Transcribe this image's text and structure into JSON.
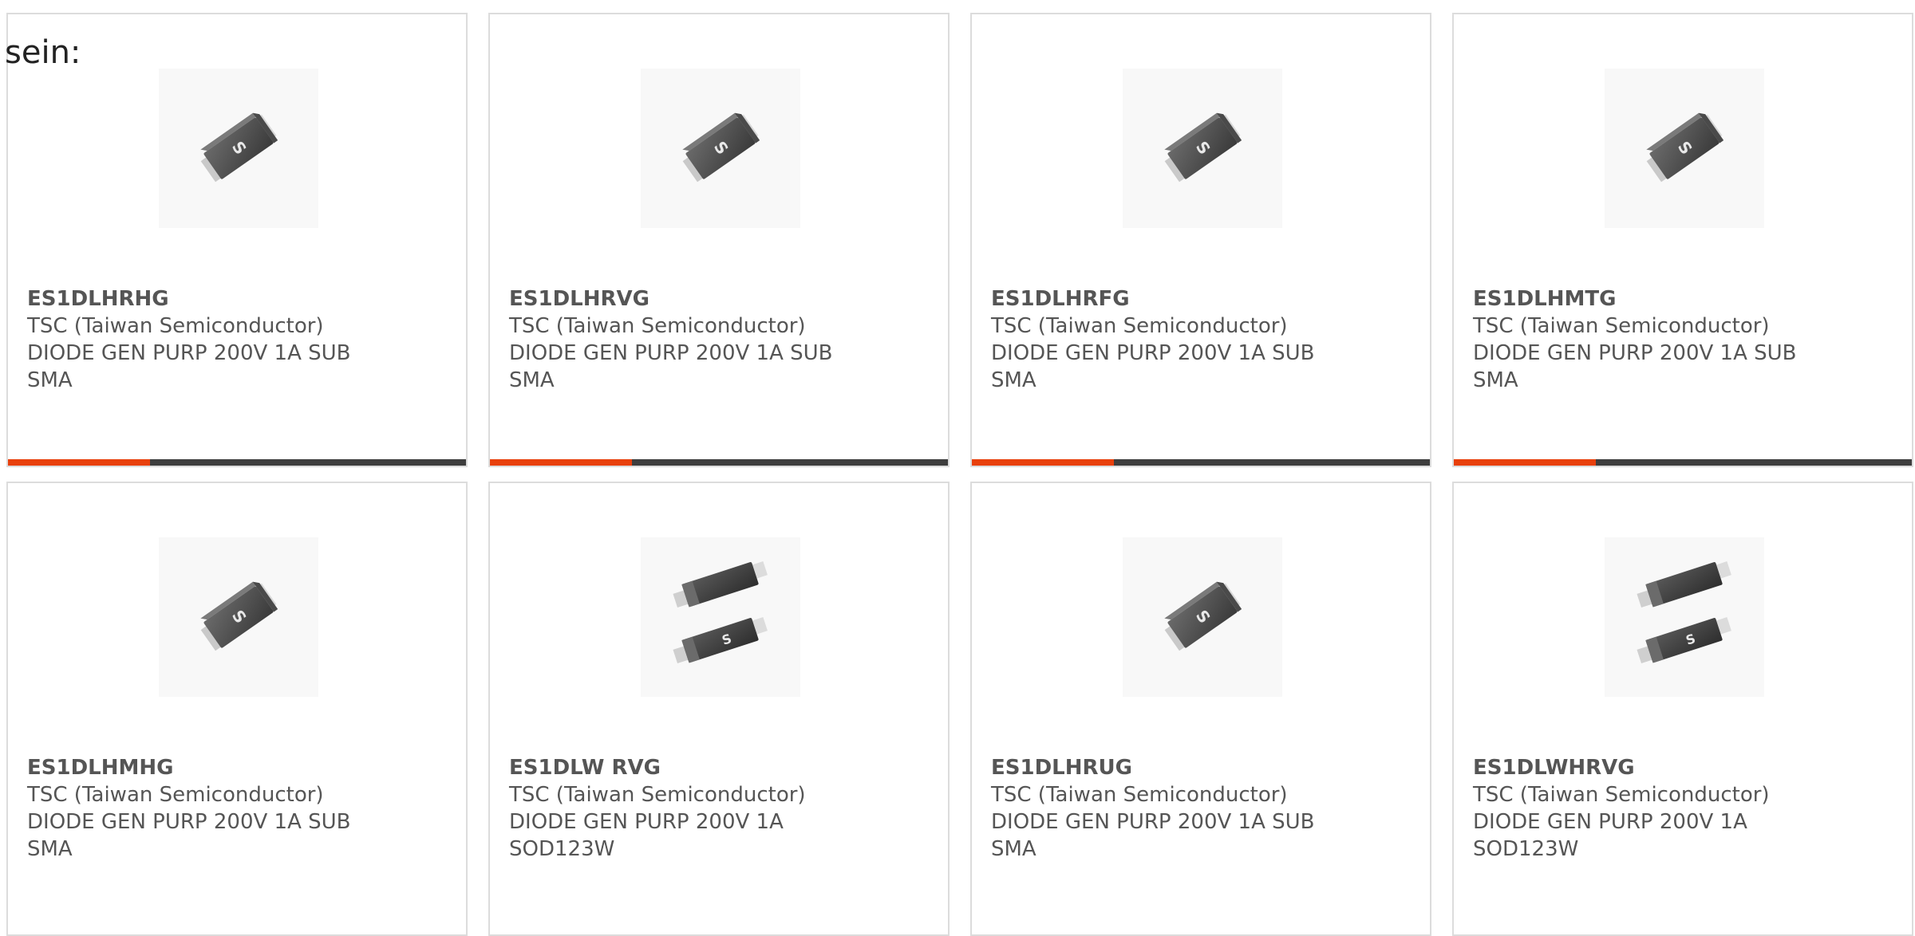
{
  "intro_text": "sein:",
  "colors": {
    "accent": "#e8400c",
    "bar_dark": "#3e3e3e",
    "text": "#555555",
    "border": "#dcdcdc"
  },
  "products": [
    {
      "part_number": "ES1DLHRHG",
      "manufacturer": "TSC (Taiwan Semiconductor)",
      "description_line1": "DIODE GEN PURP 200V 1A SUB",
      "description_line2": "SMA",
      "image_icon": "diode-sma-package-icon",
      "progress": 0.31
    },
    {
      "part_number": "ES1DLHRVG",
      "manufacturer": "TSC (Taiwan Semiconductor)",
      "description_line1": "DIODE GEN PURP 200V 1A SUB",
      "description_line2": "SMA",
      "image_icon": "diode-sma-package-icon",
      "progress": 0.31
    },
    {
      "part_number": "ES1DLHRFG",
      "manufacturer": "TSC (Taiwan Semiconductor)",
      "description_line1": "DIODE GEN PURP 200V 1A SUB",
      "description_line2": "SMA",
      "image_icon": "diode-sma-package-icon",
      "progress": 0.31
    },
    {
      "part_number": "ES1DLHMTG",
      "manufacturer": "TSC (Taiwan Semiconductor)",
      "description_line1": "DIODE GEN PURP 200V 1A SUB",
      "description_line2": "SMA",
      "image_icon": "diode-sma-package-icon",
      "progress": 0.31
    },
    {
      "part_number": "ES1DLHMHG",
      "manufacturer": "TSC (Taiwan Semiconductor)",
      "description_line1": "DIODE GEN PURP 200V 1A SUB",
      "description_line2": "SMA",
      "image_icon": "diode-sma-package-icon"
    },
    {
      "part_number": "ES1DLW RVG",
      "manufacturer": "TSC (Taiwan Semiconductor)",
      "description_line1": "DIODE GEN PURP 200V 1A",
      "description_line2": "SOD123W",
      "image_icon": "diode-sod123w-package-icon"
    },
    {
      "part_number": "ES1DLHRUG",
      "manufacturer": "TSC (Taiwan Semiconductor)",
      "description_line1": "DIODE GEN PURP 200V 1A SUB",
      "description_line2": "SMA",
      "image_icon": "diode-sma-package-icon"
    },
    {
      "part_number": "ES1DLWHRVG",
      "manufacturer": "TSC (Taiwan Semiconductor)",
      "description_line1": "DIODE GEN PURP 200V 1A",
      "description_line2": "SOD123W",
      "image_icon": "diode-sod123w-package-icon"
    }
  ]
}
